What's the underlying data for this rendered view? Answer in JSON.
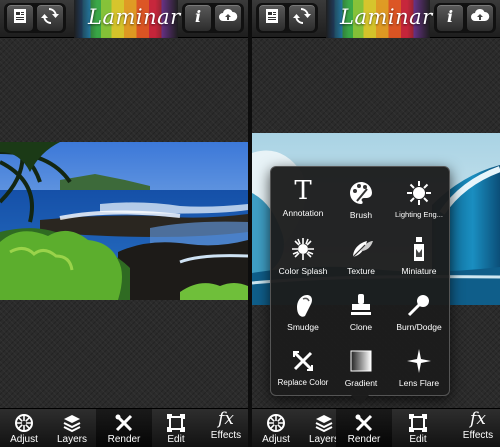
{
  "app": {
    "logo": "Laminar"
  },
  "toolbar": {
    "notes_icon": "notes-icon",
    "refresh_icon": "refresh-icon",
    "info_icon": "info-icon",
    "cloud_icon": "cloud-upload-icon"
  },
  "tabs": [
    {
      "label": "Adjust",
      "icon": "aperture-icon"
    },
    {
      "label": "Layers",
      "icon": "layers-icon"
    },
    {
      "label": "Render",
      "icon": "tools-icon"
    },
    {
      "label": "Edit",
      "icon": "crop-icon"
    },
    {
      "label": "Effects",
      "icon": "fx-icon",
      "glyph": "fx"
    }
  ],
  "left_panel": {
    "active_tab": "Render"
  },
  "right_panel": {
    "active_tab": "Render",
    "render_menu": [
      {
        "label": "Annotation",
        "icon": "text-icon",
        "glyph": "T"
      },
      {
        "label": "Brush",
        "icon": "palette-icon"
      },
      {
        "label": "Lighting Eng...",
        "icon": "sun-icon"
      },
      {
        "label": "Color Splash",
        "icon": "splash-icon"
      },
      {
        "label": "Texture",
        "icon": "leaves-icon"
      },
      {
        "label": "Miniature",
        "icon": "bottle-icon"
      },
      {
        "label": "Smudge",
        "icon": "finger-icon"
      },
      {
        "label": "Clone",
        "icon": "stamp-icon"
      },
      {
        "label": "Burn/Dodge",
        "icon": "dodge-icon"
      },
      {
        "label": "Replace Color",
        "icon": "swap-icon"
      },
      {
        "label": "Gradient",
        "icon": "gradient-icon"
      },
      {
        "label": "Lens Flare",
        "icon": "flare-icon"
      }
    ]
  }
}
